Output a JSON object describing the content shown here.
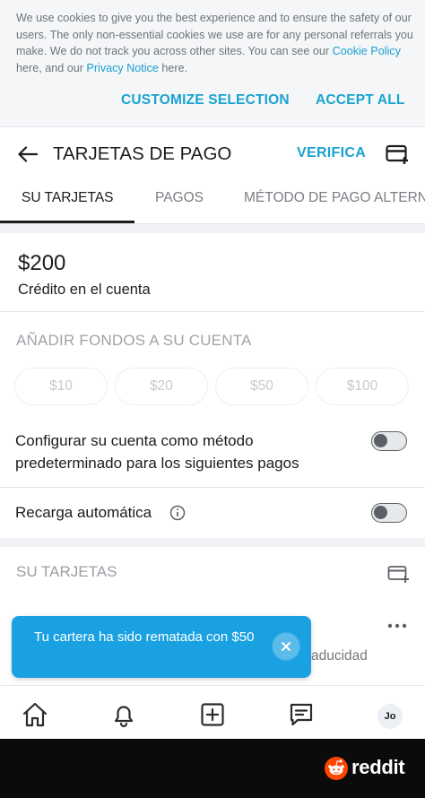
{
  "cookie_banner": {
    "text_1": "We use cookies to give you the best experience and to ensure the safety of our users. The only non-essential cookies we use are for any personal referrals you make. We do not track you across other sites. You can see our ",
    "cookie_policy_link": "Cookie Policy",
    "text_2": " here, and our ",
    "privacy_link": "Privacy Notice",
    "text_3": " here.",
    "customize_label": "CUSTOMIZE SELECTION",
    "accept_label": "ACCEPT ALL"
  },
  "header": {
    "title": "TARJETAS DE PAGO",
    "verify_label": "VERIFICA"
  },
  "tabs": [
    {
      "label": "SU TARJETAS",
      "active": true
    },
    {
      "label": "PAGOS",
      "active": false
    },
    {
      "label": "MÉTODO DE PAGO ALTERNATIVO",
      "active": false
    }
  ],
  "balance": {
    "amount": "$200",
    "label": "Crédito en el cuenta"
  },
  "add_funds": {
    "title": "AÑADIR FONDOS A SU CUENTA",
    "options": [
      "$10",
      "$20",
      "$50",
      "$100"
    ]
  },
  "settings": {
    "default_method_label": "Configurar su cuenta como método predeterminado para los siguientes pagos",
    "default_method_enabled": false,
    "auto_recharge_label": "Recarga automática",
    "auto_recharge_enabled": false
  },
  "cards": {
    "title": "SU TARJETAS",
    "expiry_partial": "aducidad"
  },
  "toast": {
    "message": "Tu cartera ha sido rematada con $50"
  },
  "bottom_nav": {
    "avatar_initials": "Jo"
  },
  "watermark": {
    "brand": "reddit"
  },
  "colors": {
    "accent": "#1aa3d0",
    "toast_bg": "#1aa1e1",
    "watermark_bg": "#0b0b0b"
  }
}
